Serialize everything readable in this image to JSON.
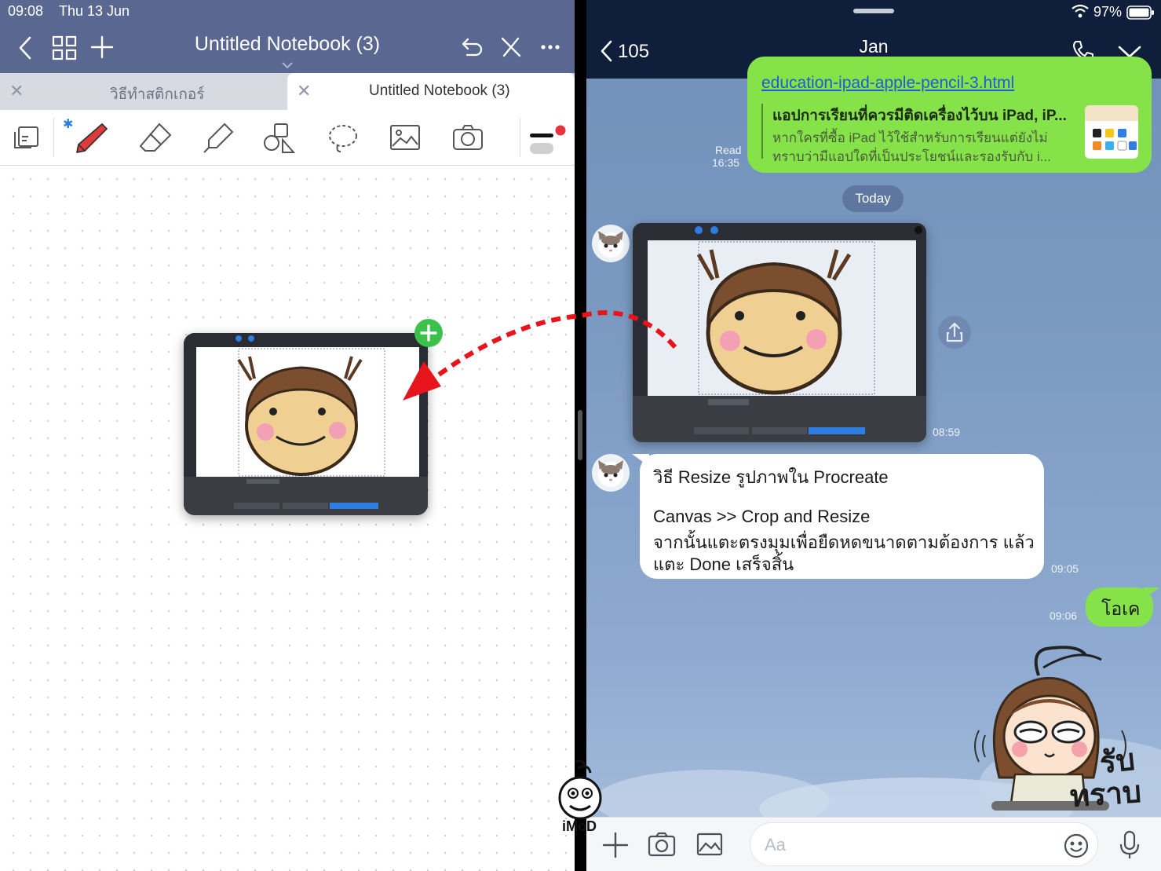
{
  "status_bar": {
    "time": "09:08",
    "date": "Thu 13 Jun",
    "battery": "97%"
  },
  "notes": {
    "title": "Untitled Notebook (3)",
    "tabs": [
      {
        "label": "วิธีทำสติกเกอร์",
        "active": false
      },
      {
        "label": "Untitled Notebook (3)",
        "active": true
      }
    ],
    "tools": [
      "page-view",
      "pen",
      "eraser",
      "highlighter",
      "shapes",
      "lasso",
      "image",
      "camera",
      "pen-settings"
    ],
    "pen_color": "#e03a3a"
  },
  "chat": {
    "name": "Jan",
    "back_count": "105",
    "link_text": "education-ipad-apple-pencil-3.html",
    "link_preview": {
      "title": "แอปการเรียนที่ควรมีติดเครื่องไว้บน iPad, iP...",
      "desc_line1": "หากใครที่ซื้อ iPad ไว้ใช้สำหรับการเรียนแต่ยังไม่",
      "desc_line2": "ทราบว่ามีแอปใดที่เป็นประโยชน์และรองรับกับ i...",
      "read_label": "Read",
      "read_time": "16:35"
    },
    "date_divider": "Today",
    "image_time": "08:59",
    "msg1": {
      "line1": "วิธี Resize รูปภาพใน Procreate",
      "line2": "Canvas >> Crop and Resize",
      "line3": "จากนั้นแตะตรงมุมเพื่อยืดหดขนาดตามต้องการ แล้ว",
      "line4": "แตะ Done เสร็จสิ้น",
      "time": "09:05"
    },
    "msg2": {
      "text": "โอเค",
      "time": "09:06"
    },
    "sticker_text_1": "รับ",
    "sticker_text_2": "ทราบ",
    "input_placeholder": "Aa"
  },
  "watermark": "iMoD",
  "colors": {
    "notes_header": "#5a6891",
    "chat_header": "#0f1e3a",
    "bubble_green": "#85e249",
    "arrow_red": "#e8141b",
    "add_badge": "#3cc14a"
  }
}
